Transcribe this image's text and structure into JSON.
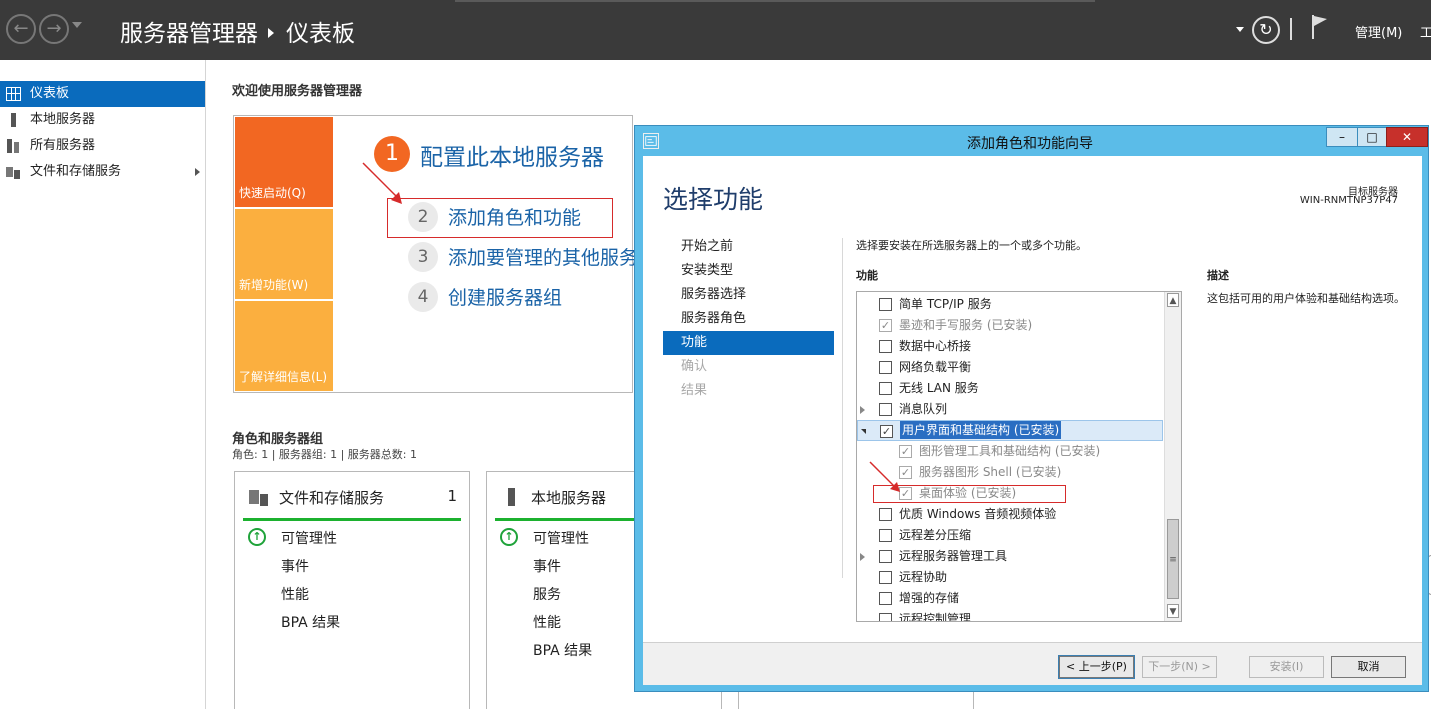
{
  "app": {
    "title": "服务器管理器",
    "page": "仪表板",
    "menus": [
      "管理(M)",
      "工"
    ]
  },
  "leftnav": {
    "items": [
      {
        "label": "仪表板",
        "icon": "dashboard-icon",
        "active": true
      },
      {
        "label": "本地服务器",
        "icon": "server-icon"
      },
      {
        "label": "所有服务器",
        "icon": "servers-icon"
      },
      {
        "label": "文件和存储服务",
        "icon": "file-storage-icon",
        "has_arrow": true
      }
    ]
  },
  "welcome": "欢迎使用服务器管理器",
  "tiles": [
    "快速启动(Q)",
    "新增功能(W)",
    "了解详细信息(L)"
  ],
  "steps": [
    {
      "num": "1",
      "label": "配置此本地服务器"
    },
    {
      "num": "2",
      "label": "添加角色和功能"
    },
    {
      "num": "3",
      "label": "添加要管理的其他服务器"
    },
    {
      "num": "4",
      "label": "创建服务器组"
    }
  ],
  "groups": {
    "title": "角色和服务器组",
    "sub": "角色: 1 | 服务器组: 1 | 服务器总数: 1",
    "cards": [
      {
        "title": "文件和存储服务",
        "count": "1",
        "rows": [
          "可管理性",
          "事件",
          "性能",
          "BPA 结果"
        ]
      },
      {
        "title": "本地服务器",
        "count": "",
        "rows": [
          "可管理性",
          "事件",
          "服务",
          "性能",
          "BPA 结果"
        ]
      }
    ]
  },
  "dialog": {
    "title": "添加角色和功能向导",
    "heading": "选择功能",
    "target_label": "目标服务器",
    "target_value": "WIN-RNMTNP37P47",
    "nav": [
      {
        "label": "开始之前",
        "state": "normal"
      },
      {
        "label": "安装类型",
        "state": "normal"
      },
      {
        "label": "服务器选择",
        "state": "normal"
      },
      {
        "label": "服务器角色",
        "state": "normal"
      },
      {
        "label": "功能",
        "state": "active"
      },
      {
        "label": "确认",
        "state": "disabled"
      },
      {
        "label": "结果",
        "state": "disabled"
      }
    ],
    "instruction": "选择要安装在所选服务器上的一个或多个功能。",
    "features_header": "功能",
    "description_header": "描述",
    "description": "这包括可用的用户体验和基础结构选项。",
    "features": [
      {
        "label": "简单 TCP/IP 服务",
        "checked": false,
        "disabled": false,
        "level": 0,
        "expander": ""
      },
      {
        "label": "墨迹和手写服务 (已安装)",
        "checked": true,
        "disabled": true,
        "level": 0,
        "expander": ""
      },
      {
        "label": "数据中心桥接",
        "checked": false,
        "disabled": false,
        "level": 0,
        "expander": ""
      },
      {
        "label": "网络负载平衡",
        "checked": false,
        "disabled": false,
        "level": 0,
        "expander": ""
      },
      {
        "label": "无线 LAN 服务",
        "checked": false,
        "disabled": false,
        "level": 0,
        "expander": ""
      },
      {
        "label": "消息队列",
        "checked": false,
        "disabled": false,
        "level": 0,
        "expander": "collapsed"
      },
      {
        "label": "用户界面和基础结构 (已安装)",
        "checked": true,
        "disabled": false,
        "level": 0,
        "expander": "expanded",
        "selected": true
      },
      {
        "label": "图形管理工具和基础结构 (已安装)",
        "checked": true,
        "disabled": true,
        "level": 1,
        "expander": ""
      },
      {
        "label": "服务器图形 Shell (已安装)",
        "checked": true,
        "disabled": true,
        "level": 1,
        "expander": ""
      },
      {
        "label": "桌面体验 (已安装)",
        "checked": true,
        "disabled": true,
        "level": 1,
        "expander": ""
      },
      {
        "label": "优质 Windows 音频视频体验",
        "checked": false,
        "disabled": false,
        "level": 0,
        "expander": ""
      },
      {
        "label": "远程差分压缩",
        "checked": false,
        "disabled": false,
        "level": 0,
        "expander": ""
      },
      {
        "label": "远程服务器管理工具",
        "checked": false,
        "disabled": false,
        "level": 0,
        "expander": "collapsed"
      },
      {
        "label": "远程协助",
        "checked": false,
        "disabled": false,
        "level": 0,
        "expander": ""
      },
      {
        "label": "增强的存储",
        "checked": false,
        "disabled": false,
        "level": 0,
        "expander": ""
      },
      {
        "label": "远程控制管理",
        "checked": false,
        "disabled": false,
        "level": 0,
        "expander": ""
      }
    ],
    "buttons": {
      "prev": "< 上一步(P)",
      "next": "下一步(N) >",
      "install": "安装(I)",
      "cancel": "取消"
    }
  },
  "colors": {
    "accent": "#0a6bbd",
    "tile_orange_dark": "#f26722",
    "tile_orange": "#fbaf3f",
    "dialog_frame": "#5bbce8",
    "ok_green": "#1fa33a",
    "annotation_red": "#d62b2b"
  }
}
